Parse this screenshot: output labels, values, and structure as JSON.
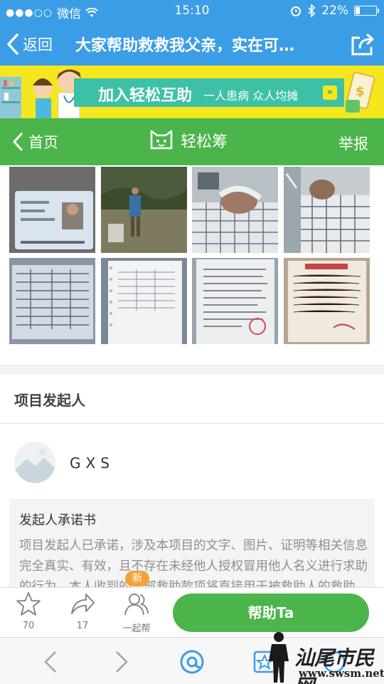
{
  "status_bar": {
    "carrier": "微信",
    "signal": "●●●○○",
    "time": "15:10",
    "battery_percent": "22%",
    "battery_level": 0.22
  },
  "nav": {
    "back_label": "返回",
    "title": "大家帮助救救我父亲，实在可…"
  },
  "banner": {
    "main_text": "加入轻松互助",
    "sub_text": "一人患病  众人均摊",
    "arrow": "»"
  },
  "header": {
    "home_label": "首页",
    "brand_name": "轻松筹",
    "report_label": "举报"
  },
  "photos": [
    {
      "name": "id-card-photo"
    },
    {
      "name": "man-standing-photo"
    },
    {
      "name": "hospital-bed-photo-1"
    },
    {
      "name": "hospital-bed-photo-2"
    },
    {
      "name": "medical-document-photo-1"
    },
    {
      "name": "medical-document-photo-2"
    },
    {
      "name": "medical-document-photo-3"
    },
    {
      "name": "handwritten-document-photo"
    }
  ],
  "initiator": {
    "section_title": "项目发起人",
    "username": "GXS"
  },
  "promise": {
    "title": "发起人承诺书",
    "body": "项目发起人已承诺，涉及本项目的文字、图片、证明等相关信息完全真实、有效，且不存在未经他人授权冒用他人名义进行求助的行为。本人收到的…部救助款项将直接用于被救助人的救助"
  },
  "actions": {
    "favorite_count": "70",
    "share_count": "17",
    "together_label": "一起帮",
    "new_badge": "新",
    "help_button": "帮助Ta"
  },
  "watermark": {
    "text": "汕尾市民网",
    "url": "www.swsm.net"
  },
  "colors": {
    "nav_blue": "#3b9de6",
    "brand_green": "#4bb54b",
    "banner_yellow": "#f4e71e",
    "banner_teal": "#3cc1a6",
    "badge_orange": "#f1a33a"
  }
}
